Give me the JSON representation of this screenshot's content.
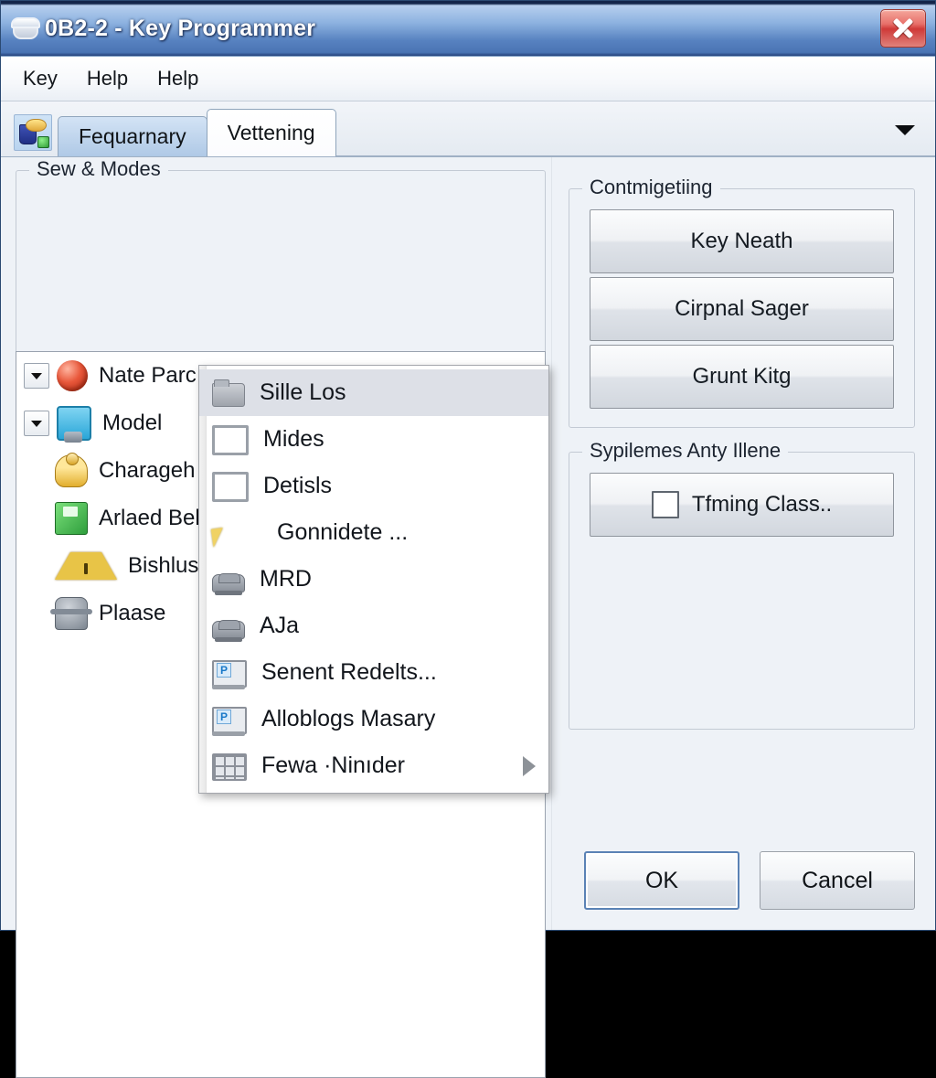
{
  "window": {
    "title": "0B2-2 - Key Programmer",
    "close_label": "Close",
    "icon": "mail-envelope-icon"
  },
  "menubar": {
    "items": [
      {
        "label": "Key"
      },
      {
        "label": "Help"
      },
      {
        "label": "Help"
      }
    ]
  },
  "tabstrip": {
    "app_icon": "paint-bucket-icon",
    "dropdown_icon": "chevron-down-icon",
    "tabs": [
      {
        "label": "Fequarnary",
        "active": false
      },
      {
        "label": "Vettening",
        "active": true
      }
    ]
  },
  "left": {
    "groupbox_title": "Sew & Modes",
    "tree": [
      {
        "label": "Nate Parc",
        "icon": "red-sphere-icon",
        "expander": true
      },
      {
        "label": "Model",
        "icon": "blue-monitor-icon",
        "expander": true
      },
      {
        "label": "Charageh",
        "icon": "gold-person-icon",
        "expander": false
      },
      {
        "label": "Arlaed Bel",
        "icon": "green-floppy-icon",
        "expander": false
      },
      {
        "label": "Bishlusato",
        "icon": "yellow-warning-icon",
        "expander": false
      },
      {
        "label": "Plaase",
        "icon": "gray-figure-icon",
        "expander": false
      }
    ]
  },
  "context_menu": {
    "items": [
      {
        "label": "Sille Los",
        "icon": "folder-icon",
        "selected": true,
        "submenu": false
      },
      {
        "label": "Mides",
        "icon": "square-icon",
        "selected": false,
        "submenu": false
      },
      {
        "label": "Detisls",
        "icon": "square-icon",
        "selected": false,
        "submenu": false
      },
      {
        "label": "Gonnidete ...",
        "icon": "cursor-arrow-icon",
        "selected": false,
        "submenu": false
      },
      {
        "label": "MRD",
        "icon": "car-icon",
        "selected": false,
        "submenu": false
      },
      {
        "label": "AJa",
        "icon": "car-icon",
        "selected": false,
        "submenu": false
      },
      {
        "label": "Senent Redelts...",
        "icon": "laptop-p-icon",
        "selected": false,
        "submenu": false
      },
      {
        "label": "Alloblogs Masary",
        "icon": "laptop-p-icon",
        "selected": false,
        "submenu": false
      },
      {
        "label": "Fewa ·Ninıder",
        "icon": "grid-icon",
        "selected": false,
        "submenu": true
      }
    ]
  },
  "right": {
    "group1": {
      "title": "Contmigetiing",
      "buttons": [
        {
          "label": "Key Neath"
        },
        {
          "label": "Cirpnal Sager"
        },
        {
          "label": "Grunt Kitg"
        }
      ]
    },
    "group2": {
      "title": "Sypilemes Anty Illene",
      "buttons": [
        {
          "label": "Tfming Class..",
          "checkbox": true
        }
      ]
    }
  },
  "footer": {
    "ok_label": "OK",
    "cancel_label": "Cancel"
  },
  "colors": {
    "title_bar_top": "#b6cfee",
    "title_bar_bottom": "#4a74b4",
    "close_red": "#cf3a38",
    "dialog_bg": "#eef2f7",
    "tab_active": "#ffffff",
    "tab_inactive": "#bfd5ee",
    "menu_selected": "#dde0e7",
    "default_button_border": "#5a82b5"
  }
}
